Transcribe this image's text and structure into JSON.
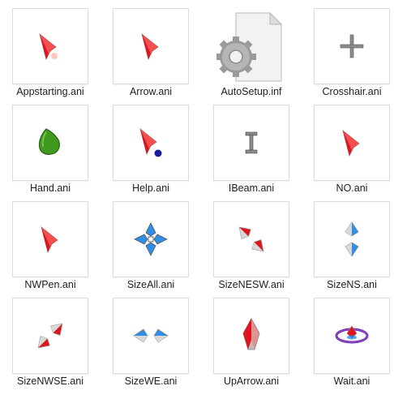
{
  "files": [
    {
      "name": "Appstarting.ani",
      "icon": "red-pointer-busy-icon"
    },
    {
      "name": "Arrow.ani",
      "icon": "red-pointer-icon"
    },
    {
      "name": "AutoSetup.inf",
      "icon": "settings-file-icon"
    },
    {
      "name": "Crosshair.ani",
      "icon": "crosshair-icon"
    },
    {
      "name": "Hand.ani",
      "icon": "green-hand-icon"
    },
    {
      "name": "Help.ani",
      "icon": "red-pointer-help-icon"
    },
    {
      "name": "IBeam.ani",
      "icon": "ibeam-icon"
    },
    {
      "name": "NO.ani",
      "icon": "red-pointer-icon"
    },
    {
      "name": "NWPen.ani",
      "icon": "red-pointer-icon"
    },
    {
      "name": "SizeAll.ani",
      "icon": "move-all-icon"
    },
    {
      "name": "SizeNESW.ani",
      "icon": "resize-nesw-icon"
    },
    {
      "name": "SizeNS.ani",
      "icon": "resize-ns-icon"
    },
    {
      "name": "SizeNWSE.ani",
      "icon": "resize-nwse-icon"
    },
    {
      "name": "SizeWE.ani",
      "icon": "resize-we-icon"
    },
    {
      "name": "UpArrow.ani",
      "icon": "up-arrow-icon"
    },
    {
      "name": "Wait.ani",
      "icon": "wait-ring-icon"
    }
  ],
  "colors": {
    "pointer_red": "#e0141c",
    "pointer_silver": "#c8c8c8",
    "blue": "#2f8fe6",
    "green": "#3f9a1e",
    "help_dot": "#1a1aa0",
    "wait_purple": "#6a2aa8"
  }
}
